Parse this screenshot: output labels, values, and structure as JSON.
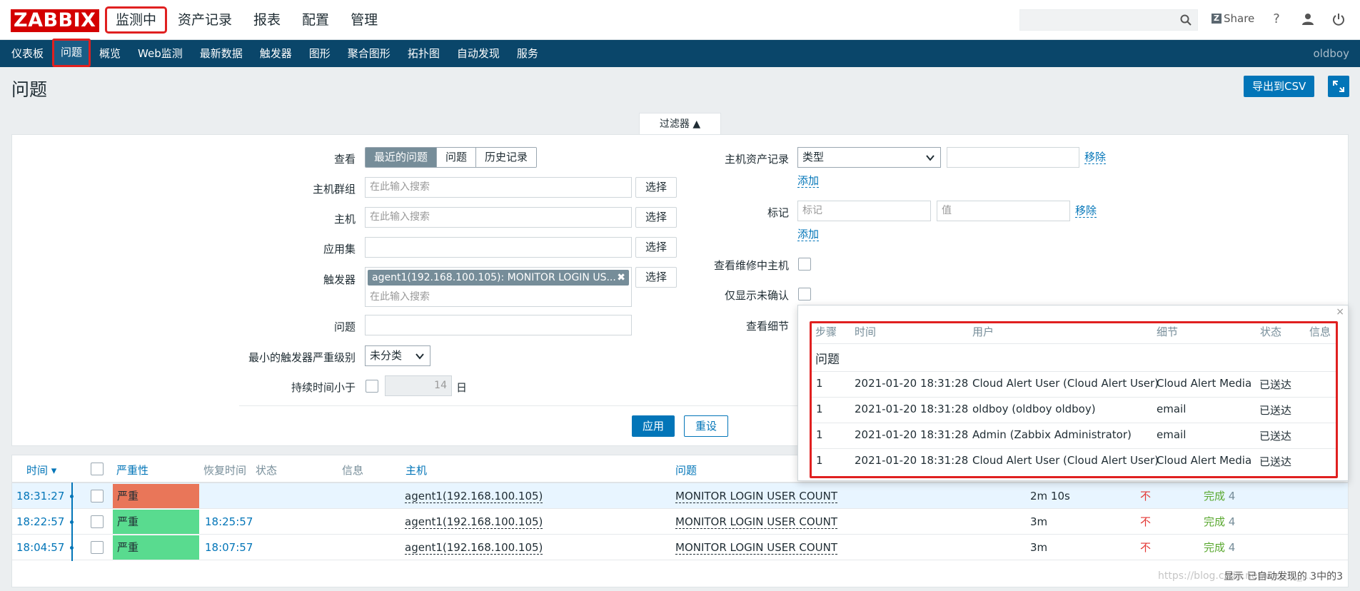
{
  "header": {
    "logo": "ZABBIX",
    "nav": [
      "监测中",
      "资产记录",
      "报表",
      "配置",
      "管理"
    ],
    "share": "Share",
    "help": "?"
  },
  "subnav": {
    "items": [
      "仪表板",
      "问题",
      "概览",
      "Web监测",
      "最新数据",
      "触发器",
      "图形",
      "聚合图形",
      "拓扑图",
      "自动发现",
      "服务"
    ],
    "user": "oldboy"
  },
  "page": {
    "title": "问题",
    "export_label": "导出到CSV"
  },
  "filter": {
    "tab_label": "过滤器 ▲",
    "view_label": "查看",
    "view_options": [
      "最近的问题",
      "问题",
      "历史记录"
    ],
    "hostgroup_label": "主机群组",
    "host_label": "主机",
    "app_label": "应用集",
    "trigger_label": "触发器",
    "trigger_chip": "agent1(192.168.100.105): MONITOR LOGIN US...",
    "problem_label": "问题",
    "severity_label": "最小的触发器严重级别",
    "severity_value": "未分类",
    "duration_label": "持续时间小于",
    "duration_value": "14",
    "duration_unit": "日",
    "search_placeholder": "在此输入搜索",
    "select_btn": "选择",
    "inventory_label": "主机资产记录",
    "inventory_type": "类型",
    "remove": "移除",
    "add": "添加",
    "tags_label": "标记",
    "tag_placeholder": "标记",
    "value_placeholder": "值",
    "maintenance_label": "查看维修中主机",
    "unack_label": "仅显示未确认",
    "details_label": "查看细节",
    "apply": "应用",
    "reset": "重设"
  },
  "table": {
    "headers": {
      "time": "时间 ▾",
      "severity": "严重性",
      "recovery": "恢复时间",
      "status": "状态",
      "info": "信息",
      "host": "主机",
      "problem": "问题"
    },
    "rows": [
      {
        "time": "18:31:27",
        "severity": "严重",
        "recovery": "",
        "host": "agent1(192.168.100.105)",
        "problem": "MONITOR LOGIN USER COUNT",
        "duration": "2m 10s",
        "ack": "不",
        "actions": "完成",
        "count": "4"
      },
      {
        "time": "18:22:57",
        "severity": "严重",
        "recovery": "18:25:57",
        "host": "agent1(192.168.100.105)",
        "problem": "MONITOR LOGIN USER COUNT",
        "duration": "3m",
        "ack": "不",
        "actions": "完成",
        "count": "4"
      },
      {
        "time": "18:04:57",
        "severity": "严重",
        "recovery": "18:07:57",
        "host": "agent1(192.168.100.105)",
        "problem": "MONITOR LOGIN USER COUNT",
        "duration": "3m",
        "ack": "不",
        "actions": "完成",
        "count": "4"
      }
    ],
    "footer": "显示 已自动发现的 3中的3",
    "watermark": "https://blog.csdn.net/weixin_..."
  },
  "popup": {
    "headers": [
      "步骤",
      "时间",
      "用户",
      "细节",
      "状态",
      "信息"
    ],
    "section": "问题",
    "rows": [
      {
        "step": "1",
        "time": "2021-01-20 18:31:28",
        "user": "Cloud Alert User (Cloud Alert User)",
        "detail": "Cloud Alert Media",
        "status": "已送达"
      },
      {
        "step": "1",
        "time": "2021-01-20 18:31:28",
        "user": "oldboy (oldboy oldboy)",
        "detail": "email",
        "status": "已送达"
      },
      {
        "step": "1",
        "time": "2021-01-20 18:31:28",
        "user": "Admin (Zabbix Administrator)",
        "detail": "email",
        "status": "已送达"
      },
      {
        "step": "1",
        "time": "2021-01-20 18:31:28",
        "user": "Cloud Alert User (Cloud Alert User)",
        "detail": "Cloud Alert Media",
        "status": "已送达"
      }
    ]
  },
  "colors": {
    "nav_bg": "#0a466a",
    "accent": "#0275b8",
    "severity_high_active": "#e97659",
    "severity_high_resolved": "#59db8f",
    "highlight": "#e02020"
  }
}
